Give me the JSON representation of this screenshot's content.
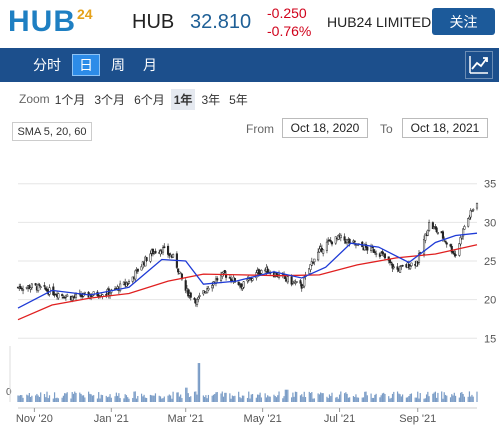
{
  "header": {
    "logo_main": "HUB",
    "logo_sup": "24",
    "ticker": "HUB",
    "price": "32.810",
    "change": "-0.250",
    "change_pct": "-0.76%",
    "company": "HUB24 LIMITED",
    "follow_label": "关注"
  },
  "nav": {
    "tabs": [
      "分时",
      "日",
      "周",
      "月"
    ],
    "active_tab": "日",
    "chart_icon": "line-chart-icon"
  },
  "zoom": {
    "label": "Zoom",
    "options": [
      "1个月",
      "3个月",
      "6个月",
      "1年",
      "3年",
      "5年"
    ],
    "selected": "1年"
  },
  "indicator": "SMA 5, 20, 60",
  "range": {
    "from_label": "From",
    "from_value": "Oct 18, 2020",
    "to_label": "To",
    "to_value": "Oct 18, 2021"
  },
  "colors": {
    "accent": "#1c4f8c",
    "negative": "#d0021b",
    "sma_short": "#1f3bd6",
    "sma_long": "#e02020"
  },
  "chart_data": {
    "type": "candlestick",
    "x_tick_labels": [
      "Nov '20",
      "Jan '21",
      "Mar '21",
      "May '21",
      "Jul '21",
      "Sep '21"
    ],
    "x_tick_dates": [
      "2020-11-01",
      "2021-01-01",
      "2021-03-01",
      "2021-05-01",
      "2021-07-01",
      "2021-09-01"
    ],
    "x_range": [
      "2020-10-19",
      "2021-10-18"
    ],
    "y_ticks": [
      15,
      20,
      25,
      30,
      35
    ],
    "ylim": [
      14,
      36
    ],
    "volume_axis_label": "0",
    "close_series": [
      {
        "date": "2020-10-19",
        "close": 21.6
      },
      {
        "date": "2020-11-01",
        "close": 21.7
      },
      {
        "date": "2020-11-15",
        "close": 21.0
      },
      {
        "date": "2020-12-01",
        "close": 20.3
      },
      {
        "date": "2020-12-15",
        "close": 20.6
      },
      {
        "date": "2021-01-01",
        "close": 21.0
      },
      {
        "date": "2021-01-15",
        "close": 22.3
      },
      {
        "date": "2021-02-01",
        "close": 26.0
      },
      {
        "date": "2021-02-10",
        "close": 26.6
      },
      {
        "date": "2021-02-20",
        "close": 25.3
      },
      {
        "date": "2021-03-01",
        "close": 21.2
      },
      {
        "date": "2021-03-10",
        "close": 19.8
      },
      {
        "date": "2021-03-20",
        "close": 22.0
      },
      {
        "date": "2021-04-01",
        "close": 23.3
      },
      {
        "date": "2021-04-15",
        "close": 21.8
      },
      {
        "date": "2021-05-01",
        "close": 24.0
      },
      {
        "date": "2021-05-15",
        "close": 23.0
      },
      {
        "date": "2021-06-01",
        "close": 21.7
      },
      {
        "date": "2021-06-10",
        "close": 25.2
      },
      {
        "date": "2021-06-20",
        "close": 27.2
      },
      {
        "date": "2021-07-01",
        "close": 28.0
      },
      {
        "date": "2021-07-15",
        "close": 27.0
      },
      {
        "date": "2021-08-01",
        "close": 26.2
      },
      {
        "date": "2021-08-15",
        "close": 23.8
      },
      {
        "date": "2021-09-01",
        "close": 25.0
      },
      {
        "date": "2021-09-10",
        "close": 29.8
      },
      {
        "date": "2021-09-20",
        "close": 28.3
      },
      {
        "date": "2021-10-01",
        "close": 25.8
      },
      {
        "date": "2021-10-08",
        "close": 29.5
      },
      {
        "date": "2021-10-18",
        "close": 32.8
      }
    ],
    "sma_short": {
      "name": "SMA 20",
      "values": [
        {
          "date": "2020-10-19",
          "v": 18.9
        },
        {
          "date": "2020-11-15",
          "v": 21.2
        },
        {
          "date": "2020-12-15",
          "v": 20.6
        },
        {
          "date": "2021-01-15",
          "v": 21.6
        },
        {
          "date": "2021-02-10",
          "v": 25.2
        },
        {
          "date": "2021-03-01",
          "v": 25.0
        },
        {
          "date": "2021-03-15",
          "v": 22.0
        },
        {
          "date": "2021-04-10",
          "v": 22.4
        },
        {
          "date": "2021-05-10",
          "v": 23.6
        },
        {
          "date": "2021-06-01",
          "v": 22.8
        },
        {
          "date": "2021-06-20",
          "v": 24.2
        },
        {
          "date": "2021-07-10",
          "v": 27.3
        },
        {
          "date": "2021-08-01",
          "v": 26.8
        },
        {
          "date": "2021-08-25",
          "v": 24.8
        },
        {
          "date": "2021-09-15",
          "v": 27.4
        },
        {
          "date": "2021-10-01",
          "v": 28.3
        },
        {
          "date": "2021-10-18",
          "v": 28.6
        }
      ]
    },
    "sma_long": {
      "name": "SMA 60",
      "values": [
        {
          "date": "2020-10-19",
          "v": 17.4
        },
        {
          "date": "2020-11-15",
          "v": 19.3
        },
        {
          "date": "2020-12-15",
          "v": 20.2
        },
        {
          "date": "2021-01-15",
          "v": 20.8
        },
        {
          "date": "2021-02-15",
          "v": 22.4
        },
        {
          "date": "2021-03-15",
          "v": 23.3
        },
        {
          "date": "2021-04-15",
          "v": 23.2
        },
        {
          "date": "2021-05-15",
          "v": 23.1
        },
        {
          "date": "2021-06-15",
          "v": 23.2
        },
        {
          "date": "2021-07-15",
          "v": 24.5
        },
        {
          "date": "2021-08-15",
          "v": 25.4
        },
        {
          "date": "2021-09-15",
          "v": 25.9
        },
        {
          "date": "2021-10-18",
          "v": 27.1
        }
      ]
    },
    "volume_spikes": [
      {
        "date": "2021-03-01",
        "rel": 0.35
      },
      {
        "date": "2021-03-12",
        "rel": 0.95
      },
      {
        "date": "2021-05-20",
        "rel": 0.3
      }
    ],
    "grid": true
  }
}
